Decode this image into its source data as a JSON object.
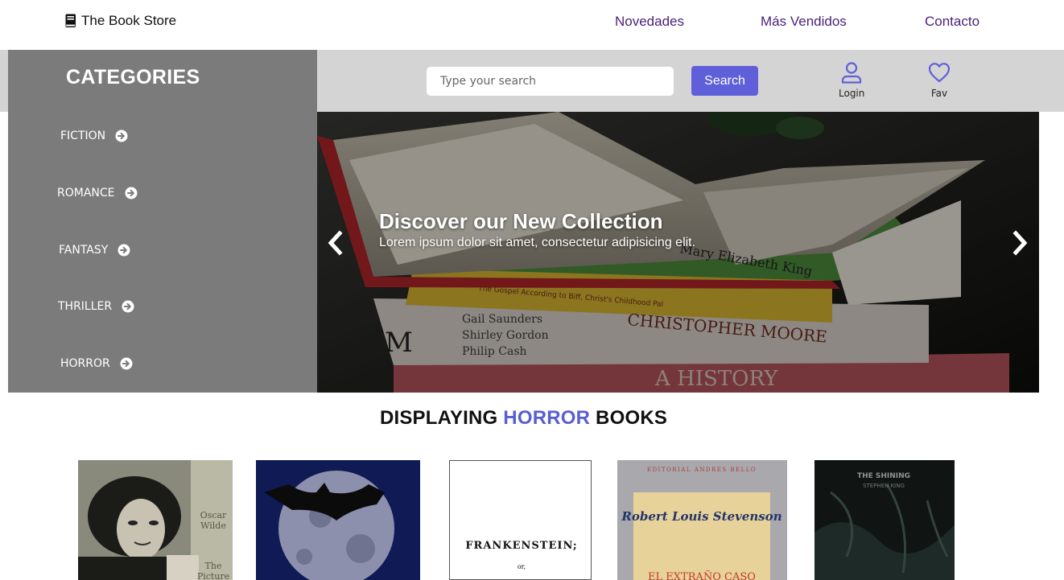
{
  "nav": {
    "brand": "The Book Store",
    "brand_icon": "book-icon",
    "links": [
      "Novedades",
      "Más Vendidos",
      "Contacto"
    ],
    "link_color": "#4b1f7a"
  },
  "sidebar": {
    "title": "CATEGORIES",
    "background": "#7b7b7b",
    "items": [
      {
        "label": "FICTION",
        "icon": "arrow-circle-right-icon"
      },
      {
        "label": "ROMANCE",
        "icon": "arrow-circle-right-icon"
      },
      {
        "label": "FANTASY",
        "icon": "arrow-circle-right-icon"
      },
      {
        "label": "THRILLER",
        "icon": "arrow-circle-right-icon"
      },
      {
        "label": "HORROR",
        "icon": "arrow-circle-right-icon"
      }
    ]
  },
  "search": {
    "placeholder": "Type your search",
    "value": "",
    "button_label": "Search",
    "button_color": "#5f5fd9"
  },
  "utilities": [
    {
      "label": "Login",
      "icon": "user-icon"
    },
    {
      "label": "Fav",
      "icon": "heart-icon"
    }
  ],
  "hero": {
    "title": "Discover our New Collection",
    "subtitle": "Lorem ipsum dolor sit amet, consectetur adipisicing elit.",
    "book_spines": [
      "Mary Elizabeth King",
      "CHRISTOPHER MOORE",
      "The Gospel According to Biff, Christ's Childhood Pal",
      "Gail Saunders",
      "Shirley Gordon",
      "Philip Cash",
      "A HISTORY",
      "M"
    ]
  },
  "listing": {
    "prefix": "DISPLAYING",
    "category": "HORROR",
    "suffix": "BOOKS",
    "highlight_color": "#5a5fd0"
  },
  "books": [
    {
      "cover_text": [
        "Oscar",
        "Wilde",
        "The",
        "Picture"
      ]
    },
    {
      "cover_text": []
    },
    {
      "cover_text": [
        "FRANKENSTEIN;",
        "or,"
      ]
    },
    {
      "cover_text": [
        "EDITORIAL ANDRES BELLO",
        "Robert Louis Stevenson",
        "EL EXTRAÑO CASO"
      ]
    },
    {
      "cover_text": [
        "THE SHINING",
        "STEPHEN KING"
      ]
    }
  ]
}
